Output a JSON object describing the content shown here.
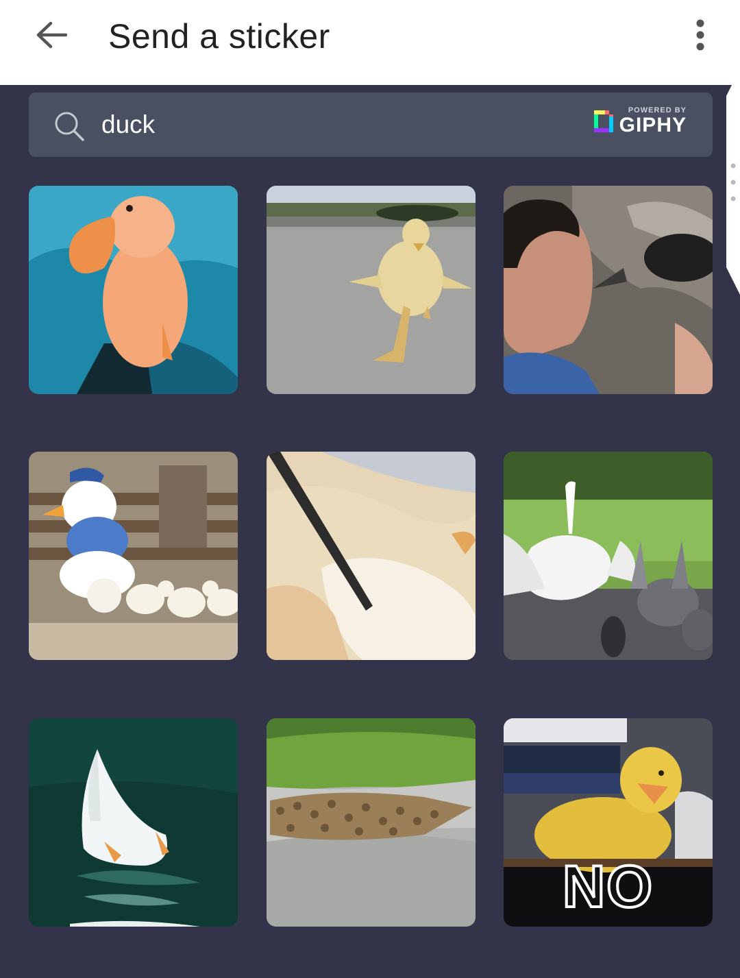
{
  "appbar": {
    "title": "Send a sticker",
    "back_icon": "arrow-left-icon",
    "menu_icon": "more-vertical-icon"
  },
  "search": {
    "value": "duck",
    "icon": "search-icon",
    "powered_by": "POWERED BY",
    "brand": "GIPHY"
  },
  "stickers": [
    {
      "name": "sticker-duckling-closeup"
    },
    {
      "name": "sticker-duckling-running"
    },
    {
      "name": "sticker-man-and-duck"
    },
    {
      "name": "sticker-donald-duck-ducklings"
    },
    {
      "name": "sticker-duck-petting-pen"
    },
    {
      "name": "sticker-goose-pigeons"
    },
    {
      "name": "sticker-duck-diving"
    },
    {
      "name": "sticker-duck-flock-road"
    },
    {
      "name": "sticker-duckling-no",
      "caption": "NO"
    }
  ],
  "colors": {
    "background": "#33344a",
    "search_background": "#4a5061",
    "appbar": "#ffffff"
  }
}
